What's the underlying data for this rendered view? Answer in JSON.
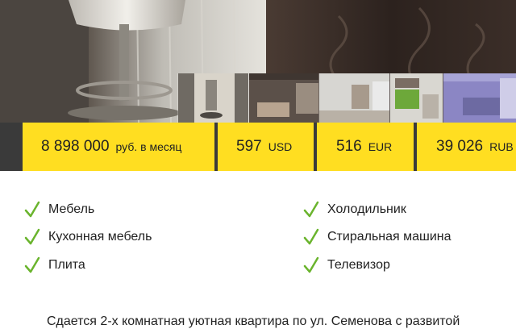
{
  "gallery": {
    "main_photo": "apartment-interior-photo",
    "thumbnails": [
      {
        "name": "chair-room-thumb"
      },
      {
        "name": "living-room-thumb"
      },
      {
        "name": "bright-room-thumb"
      },
      {
        "name": "kitchen-thumb"
      },
      {
        "name": "purple-bedroom-thumb"
      },
      {
        "name": "window-room-thumb"
      }
    ]
  },
  "prices": [
    {
      "amount": "8 898 000",
      "unit": "руб. в месяц"
    },
    {
      "amount": "597",
      "unit": "USD"
    },
    {
      "amount": "516",
      "unit": "EUR"
    },
    {
      "amount": "39 026",
      "unit": "RUB"
    }
  ],
  "features": {
    "left": [
      "Мебель",
      "Кухонная мебель",
      "Плита"
    ],
    "right": [
      "Холодильник",
      "Стиральная машина",
      "Телевизор"
    ]
  },
  "description": "Сдается 2-х комнатная уютная квартира по ул. Семенова с развитой",
  "colors": {
    "accent": "#ffde21",
    "check": "#6ab42d",
    "divider": "#3a3a3a"
  }
}
